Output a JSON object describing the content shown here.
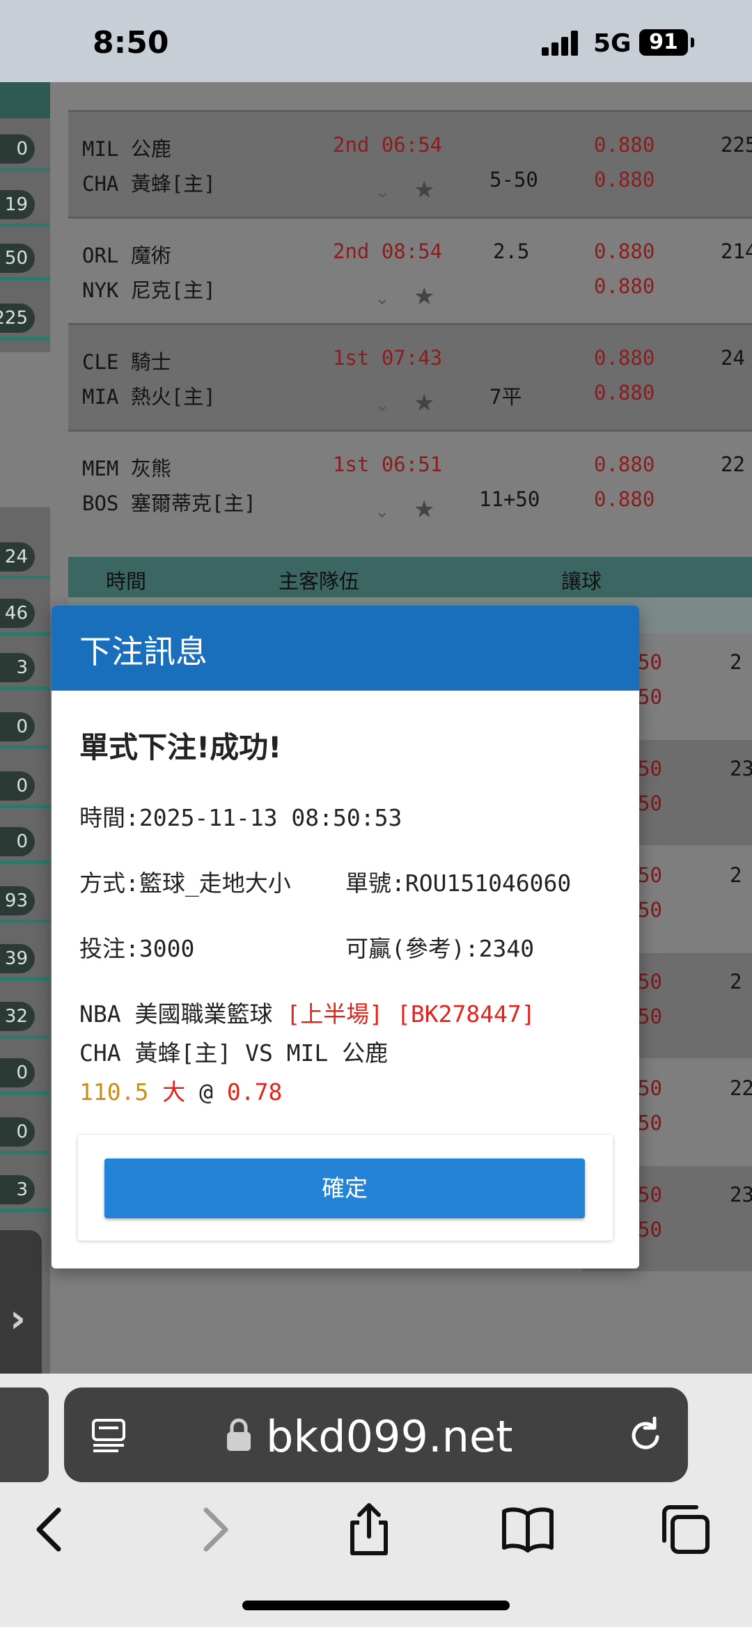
{
  "status": {
    "time": "8:50",
    "network": "5G",
    "battery": "91"
  },
  "left_pills": [
    "0",
    "19",
    "50",
    "225",
    "24",
    "46",
    "3",
    "0",
    "0",
    "0",
    "93",
    "39",
    "32",
    "0",
    "0",
    "3"
  ],
  "games": [
    {
      "away": "MIL 公鹿",
      "home": "CHA 黃蜂[主]",
      "clock": "2nd 06:54",
      "handicap_top": "",
      "handicap_bottom": "5-50",
      "odd_top": "0.880",
      "odd_bottom": "0.880",
      "far": "225"
    },
    {
      "away": "ORL 魔術",
      "home": "NYK 尼克[主]",
      "clock": "2nd 08:54",
      "handicap_top": "2.5",
      "handicap_bottom": "",
      "odd_top": "0.880",
      "odd_bottom": "0.880",
      "far": "214"
    },
    {
      "away": "CLE 騎士",
      "home": "MIA 熱火[主]",
      "clock": "1st 07:43",
      "handicap_top": "",
      "handicap_bottom": "7平",
      "odd_top": "0.880",
      "odd_bottom": "0.880",
      "far": "24"
    },
    {
      "away": "MEM 灰熊",
      "home": "BOS 塞爾蒂克[主]",
      "clock": "1st 06:51",
      "handicap_top": "",
      "handicap_bottom": "11+50",
      "odd_top": "0.880",
      "odd_bottom": "0.880",
      "far": "22"
    }
  ],
  "table_header": {
    "time": "時間",
    "teams": "主客隊伍",
    "handicap": "讓球"
  },
  "right_strip": [
    {
      "a": "50",
      "b": "50",
      "n": "2"
    },
    {
      "a": "50",
      "b": "50",
      "n": "23"
    },
    {
      "a": "50",
      "b": "50",
      "n": "2"
    },
    {
      "a": "50",
      "b": "50",
      "n": "2"
    },
    {
      "a": "50",
      "b": "50",
      "n": "22"
    },
    {
      "a": "50",
      "b": "50",
      "n": "23"
    }
  ],
  "modal": {
    "title": "下注訊息",
    "success": "單式下注!成功!",
    "time_line": "時間:2025-11-13 08:50:53",
    "method": "方式:籃球_走地大小",
    "order": "單號:ROU151046060",
    "stake": "投注:3000",
    "win": "可贏(參考):2340",
    "league": "NBA 美國職業籃球",
    "period": "[上半場]",
    "code": "[BK278447]",
    "matchup": "CHA 黃蜂[主] VS MIL 公鹿",
    "line_value": "110.5",
    "pick": "大",
    "at": "@",
    "odds": "0.78",
    "confirm": "確定"
  },
  "browser": {
    "url": "bkd099.net"
  }
}
